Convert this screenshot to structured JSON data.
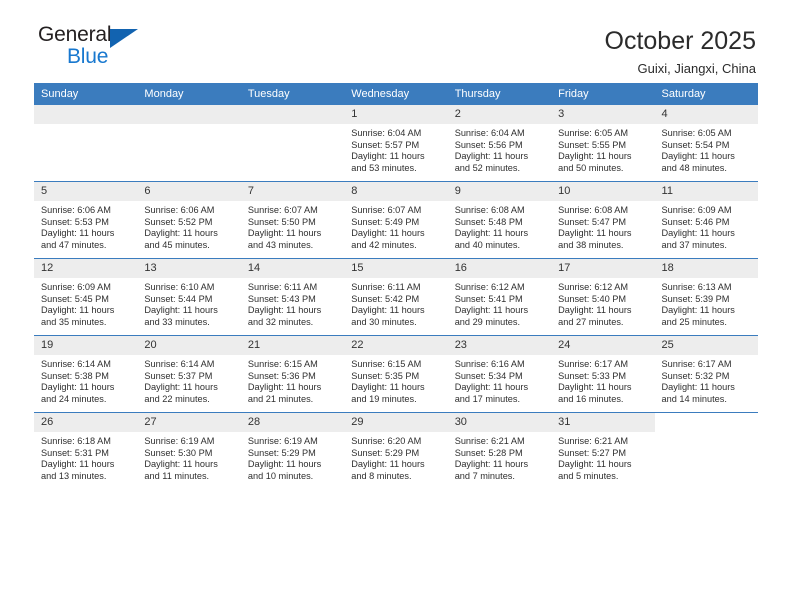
{
  "brand": {
    "name_top": "General",
    "name_bottom": "Blue",
    "flag_icon": "triangle-flag-icon",
    "color_dark": "#231f20",
    "color_blue": "#1878cf"
  },
  "header": {
    "title": "October 2025",
    "subtitle": "Guixi, Jiangxi, China"
  },
  "theme": {
    "header_blue": "#3b7cbe",
    "day_band_gray": "#ededed",
    "text": "#2f2f2f"
  },
  "weekdays": [
    "Sunday",
    "Monday",
    "Tuesday",
    "Wednesday",
    "Thursday",
    "Friday",
    "Saturday"
  ],
  "weeks": [
    [
      {
        "day": "",
        "empty": true
      },
      {
        "day": "",
        "empty": true
      },
      {
        "day": "",
        "empty": true
      },
      {
        "day": "1",
        "sunrise": "Sunrise: 6:04 AM",
        "sunset": "Sunset: 5:57 PM",
        "daylight1": "Daylight: 11 hours",
        "daylight2": "and 53 minutes."
      },
      {
        "day": "2",
        "sunrise": "Sunrise: 6:04 AM",
        "sunset": "Sunset: 5:56 PM",
        "daylight1": "Daylight: 11 hours",
        "daylight2": "and 52 minutes."
      },
      {
        "day": "3",
        "sunrise": "Sunrise: 6:05 AM",
        "sunset": "Sunset: 5:55 PM",
        "daylight1": "Daylight: 11 hours",
        "daylight2": "and 50 minutes."
      },
      {
        "day": "4",
        "sunrise": "Sunrise: 6:05 AM",
        "sunset": "Sunset: 5:54 PM",
        "daylight1": "Daylight: 11 hours",
        "daylight2": "and 48 minutes."
      }
    ],
    [
      {
        "day": "5",
        "sunrise": "Sunrise: 6:06 AM",
        "sunset": "Sunset: 5:53 PM",
        "daylight1": "Daylight: 11 hours",
        "daylight2": "and 47 minutes."
      },
      {
        "day": "6",
        "sunrise": "Sunrise: 6:06 AM",
        "sunset": "Sunset: 5:52 PM",
        "daylight1": "Daylight: 11 hours",
        "daylight2": "and 45 minutes."
      },
      {
        "day": "7",
        "sunrise": "Sunrise: 6:07 AM",
        "sunset": "Sunset: 5:50 PM",
        "daylight1": "Daylight: 11 hours",
        "daylight2": "and 43 minutes."
      },
      {
        "day": "8",
        "sunrise": "Sunrise: 6:07 AM",
        "sunset": "Sunset: 5:49 PM",
        "daylight1": "Daylight: 11 hours",
        "daylight2": "and 42 minutes."
      },
      {
        "day": "9",
        "sunrise": "Sunrise: 6:08 AM",
        "sunset": "Sunset: 5:48 PM",
        "daylight1": "Daylight: 11 hours",
        "daylight2": "and 40 minutes."
      },
      {
        "day": "10",
        "sunrise": "Sunrise: 6:08 AM",
        "sunset": "Sunset: 5:47 PM",
        "daylight1": "Daylight: 11 hours",
        "daylight2": "and 38 minutes."
      },
      {
        "day": "11",
        "sunrise": "Sunrise: 6:09 AM",
        "sunset": "Sunset: 5:46 PM",
        "daylight1": "Daylight: 11 hours",
        "daylight2": "and 37 minutes."
      }
    ],
    [
      {
        "day": "12",
        "sunrise": "Sunrise: 6:09 AM",
        "sunset": "Sunset: 5:45 PM",
        "daylight1": "Daylight: 11 hours",
        "daylight2": "and 35 minutes."
      },
      {
        "day": "13",
        "sunrise": "Sunrise: 6:10 AM",
        "sunset": "Sunset: 5:44 PM",
        "daylight1": "Daylight: 11 hours",
        "daylight2": "and 33 minutes."
      },
      {
        "day": "14",
        "sunrise": "Sunrise: 6:11 AM",
        "sunset": "Sunset: 5:43 PM",
        "daylight1": "Daylight: 11 hours",
        "daylight2": "and 32 minutes."
      },
      {
        "day": "15",
        "sunrise": "Sunrise: 6:11 AM",
        "sunset": "Sunset: 5:42 PM",
        "daylight1": "Daylight: 11 hours",
        "daylight2": "and 30 minutes."
      },
      {
        "day": "16",
        "sunrise": "Sunrise: 6:12 AM",
        "sunset": "Sunset: 5:41 PM",
        "daylight1": "Daylight: 11 hours",
        "daylight2": "and 29 minutes."
      },
      {
        "day": "17",
        "sunrise": "Sunrise: 6:12 AM",
        "sunset": "Sunset: 5:40 PM",
        "daylight1": "Daylight: 11 hours",
        "daylight2": "and 27 minutes."
      },
      {
        "day": "18",
        "sunrise": "Sunrise: 6:13 AM",
        "sunset": "Sunset: 5:39 PM",
        "daylight1": "Daylight: 11 hours",
        "daylight2": "and 25 minutes."
      }
    ],
    [
      {
        "day": "19",
        "sunrise": "Sunrise: 6:14 AM",
        "sunset": "Sunset: 5:38 PM",
        "daylight1": "Daylight: 11 hours",
        "daylight2": "and 24 minutes."
      },
      {
        "day": "20",
        "sunrise": "Sunrise: 6:14 AM",
        "sunset": "Sunset: 5:37 PM",
        "daylight1": "Daylight: 11 hours",
        "daylight2": "and 22 minutes."
      },
      {
        "day": "21",
        "sunrise": "Sunrise: 6:15 AM",
        "sunset": "Sunset: 5:36 PM",
        "daylight1": "Daylight: 11 hours",
        "daylight2": "and 21 minutes."
      },
      {
        "day": "22",
        "sunrise": "Sunrise: 6:15 AM",
        "sunset": "Sunset: 5:35 PM",
        "daylight1": "Daylight: 11 hours",
        "daylight2": "and 19 minutes."
      },
      {
        "day": "23",
        "sunrise": "Sunrise: 6:16 AM",
        "sunset": "Sunset: 5:34 PM",
        "daylight1": "Daylight: 11 hours",
        "daylight2": "and 17 minutes."
      },
      {
        "day": "24",
        "sunrise": "Sunrise: 6:17 AM",
        "sunset": "Sunset: 5:33 PM",
        "daylight1": "Daylight: 11 hours",
        "daylight2": "and 16 minutes."
      },
      {
        "day": "25",
        "sunrise": "Sunrise: 6:17 AM",
        "sunset": "Sunset: 5:32 PM",
        "daylight1": "Daylight: 11 hours",
        "daylight2": "and 14 minutes."
      }
    ],
    [
      {
        "day": "26",
        "sunrise": "Sunrise: 6:18 AM",
        "sunset": "Sunset: 5:31 PM",
        "daylight1": "Daylight: 11 hours",
        "daylight2": "and 13 minutes."
      },
      {
        "day": "27",
        "sunrise": "Sunrise: 6:19 AM",
        "sunset": "Sunset: 5:30 PM",
        "daylight1": "Daylight: 11 hours",
        "daylight2": "and 11 minutes."
      },
      {
        "day": "28",
        "sunrise": "Sunrise: 6:19 AM",
        "sunset": "Sunset: 5:29 PM",
        "daylight1": "Daylight: 11 hours",
        "daylight2": "and 10 minutes."
      },
      {
        "day": "29",
        "sunrise": "Sunrise: 6:20 AM",
        "sunset": "Sunset: 5:29 PM",
        "daylight1": "Daylight: 11 hours",
        "daylight2": "and 8 minutes."
      },
      {
        "day": "30",
        "sunrise": "Sunrise: 6:21 AM",
        "sunset": "Sunset: 5:28 PM",
        "daylight1": "Daylight: 11 hours",
        "daylight2": "and 7 minutes."
      },
      {
        "day": "31",
        "sunrise": "Sunrise: 6:21 AM",
        "sunset": "Sunset: 5:27 PM",
        "daylight1": "Daylight: 11 hours",
        "daylight2": "and 5 minutes."
      },
      {
        "day": "",
        "empty": true,
        "blank": true
      }
    ]
  ]
}
